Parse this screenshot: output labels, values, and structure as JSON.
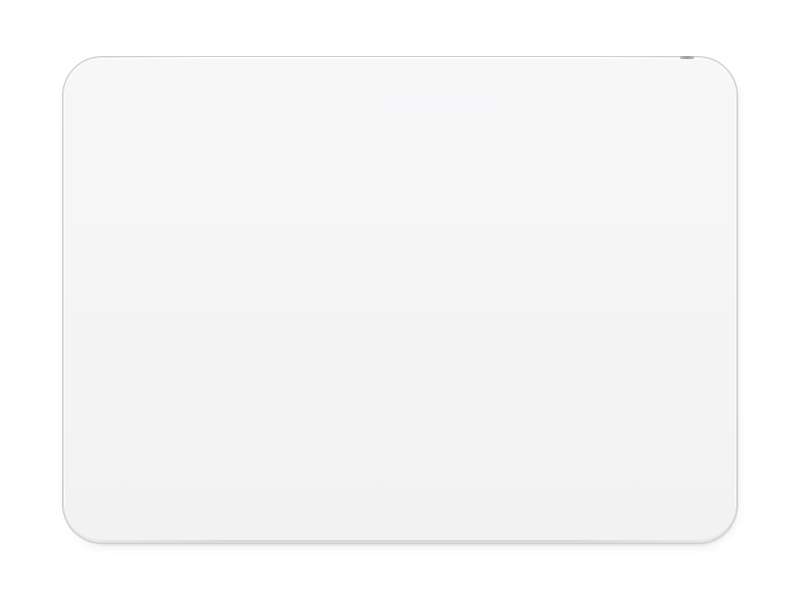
{
  "scene": {
    "subject": "trackpad",
    "background_color": "#ffffff",
    "colors": {
      "surface": "#f5f5f6",
      "rim": "#dcdcde",
      "edge": "#cfcfd2"
    },
    "icons": {
      "port": "port-notch-icon"
    }
  }
}
